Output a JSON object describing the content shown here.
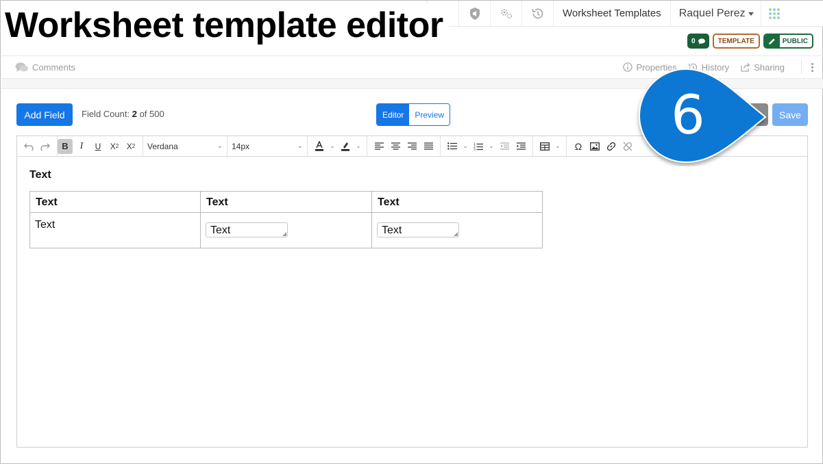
{
  "overlay_title": "Worksheet template editor",
  "topnav": {
    "icons": [
      "map-pin-icon",
      "shield-megaphone-icon",
      "gears-icon",
      "history-icon"
    ],
    "link": "Worksheet Templates",
    "user": "Raquel Perez",
    "apps_icon": "apps-grid-icon"
  },
  "badges": {
    "count": "0",
    "template": "TEMPLATE",
    "public": "PUBLIC"
  },
  "subbar": {
    "comments": "Comments",
    "properties": "Properties",
    "history": "History",
    "sharing": "Sharing"
  },
  "editor": {
    "add_field": "Add Field",
    "field_count_label": "Field Count:",
    "field_count_value": "2",
    "field_count_max": "of 500",
    "mode_editor": "Editor",
    "mode_preview": "Preview",
    "save": "Save"
  },
  "toolbar": {
    "font": "Verdana",
    "size": "14px"
  },
  "content": {
    "heading": "Text",
    "table_headers": [
      "Text",
      "Text",
      "Text"
    ],
    "row_label": "Text",
    "input1": "Text",
    "input2": "Text"
  },
  "callout": {
    "number": "6",
    "color": "#0a77d4"
  },
  "colors": {
    "primary": "#1576e6",
    "save_disabled": "#74aef2",
    "badge_green": "#1b5e3a",
    "badge_brown": "#b26a2b"
  }
}
